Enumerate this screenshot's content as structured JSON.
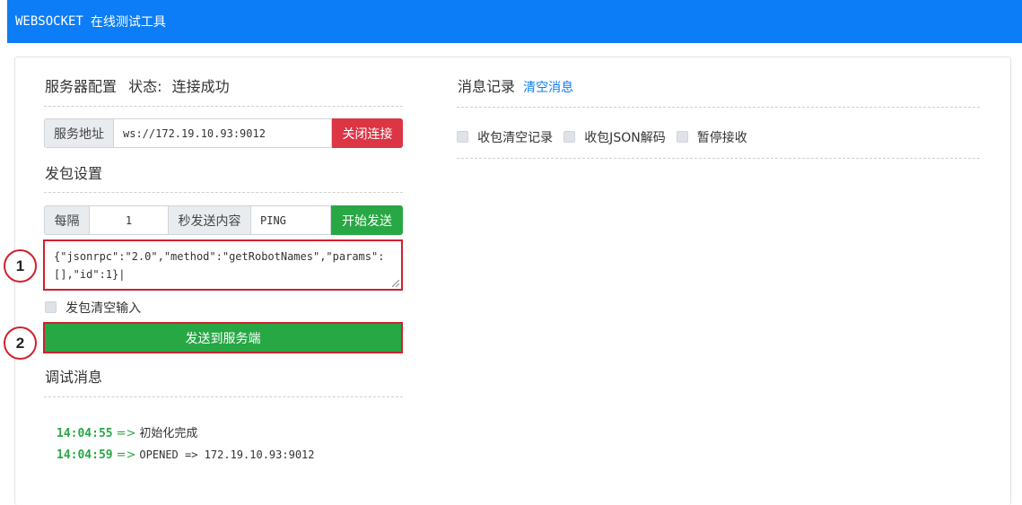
{
  "header": {
    "brand": "WEBSOCKET",
    "subtitle": "在线测试工具",
    "bg_color": "#0d7df7"
  },
  "server_config": {
    "title": "服务器配置",
    "status_prefix": "状态:",
    "status_value": "连接成功",
    "address_label": "服务地址",
    "address_value": "ws://172.19.10.93:9012",
    "close_button": "关闭连接"
  },
  "send_settings": {
    "title": "发包设置",
    "interval_prefix": "每隔",
    "interval_value": "1",
    "interval_suffix": "秒发送内容",
    "content_value": "PING",
    "start_button": "开始发送",
    "payload_line1": "{\"jsonrpc\":\"2.0\",\"method\":\"getRobotNames\",\"params\":",
    "payload_line2": "[],\"id\":1}|",
    "clear_on_send_label": "发包清空输入",
    "send_button": "发送到服务端"
  },
  "debug": {
    "title": "调试消息",
    "logs": [
      {
        "time": "14:04:55",
        "arrow": "=>",
        "message": "初始化完成"
      },
      {
        "time": "14:04:59",
        "arrow": "=>",
        "message": "OPENED => 172.19.10.93:9012"
      }
    ]
  },
  "messages": {
    "title": "消息记录",
    "clear_link": "清空消息",
    "options": [
      "收包清空记录",
      "收包JSON解码",
      "暂停接收"
    ]
  },
  "annotations": {
    "marker1": "1",
    "marker2": "2"
  },
  "colors": {
    "success": "#28a745",
    "danger": "#dc3545",
    "highlight": "#d21f2d"
  }
}
